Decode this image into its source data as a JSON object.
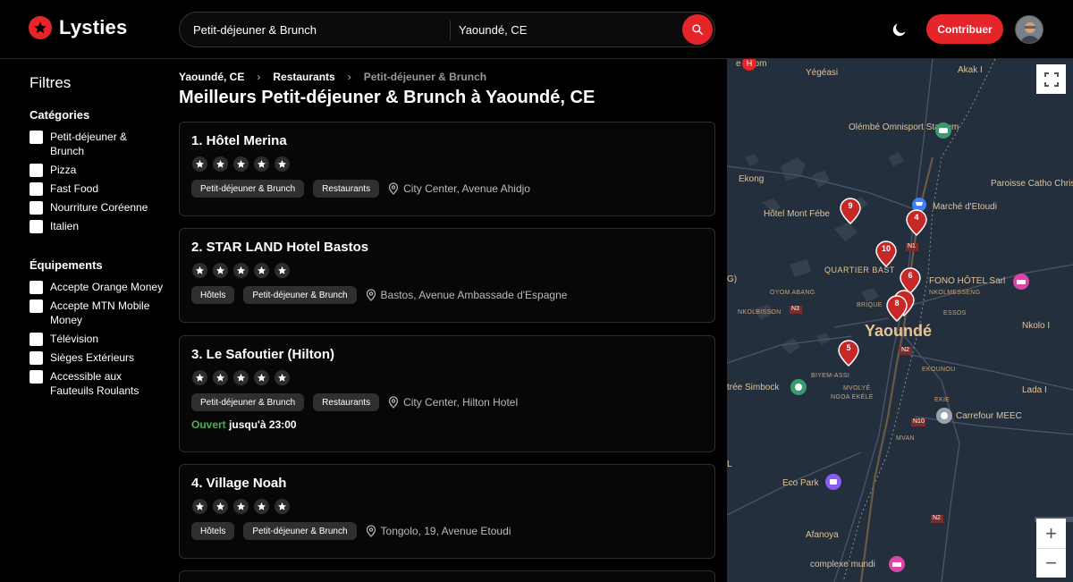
{
  "brand": {
    "name": "Lysties",
    "accent": "#e5252a"
  },
  "search": {
    "query": "Petit-déjeuner & Brunch",
    "location": "Yaoundé, CE"
  },
  "header": {
    "contribute_label": "Contribuer"
  },
  "sidebar": {
    "title": "Filtres",
    "categories_title": "Catégories",
    "categories": [
      "Petit-déjeuner & Brunch",
      "Pizza",
      "Fast Food",
      "Nourriture Coréenne",
      "Italien"
    ],
    "amenities_title": "Équipements",
    "amenities": [
      "Accepte Orange Money",
      "Accepte MTN Mobile Money",
      "Télévision",
      "Sièges Extérieurs",
      "Accessible aux Fauteuils Roulants"
    ]
  },
  "breadcrumb": [
    "Yaoundé, CE",
    "Restaurants",
    "Petit-déjeuner & Brunch"
  ],
  "page_title": "Meilleurs Petit-déjeuner & Brunch à Yaoundé, CE",
  "listings": [
    {
      "title": "1. Hôtel Merina",
      "tags": [
        "Petit-déjeuner & Brunch",
        "Restaurants"
      ],
      "address": "City Center, Avenue Ahidjo"
    },
    {
      "title": "2. STAR LAND Hotel Bastos",
      "tags": [
        "Hôtels",
        "Petit-déjeuner & Brunch"
      ],
      "address": "Bastos, Avenue Ambassade d'Espagne"
    },
    {
      "title": "3. Le Safoutier (Hilton)",
      "tags": [
        "Petit-déjeuner & Brunch",
        "Restaurants"
      ],
      "address": "City Center, Hilton Hotel",
      "open_status": "Ouvert",
      "hours": "jusqu'à 23:00"
    },
    {
      "title": "4. Village Noah",
      "tags": [
        "Hôtels",
        "Petit-déjeuner & Brunch"
      ],
      "address": "Tongolo, 19, Avenue Etoudi"
    }
  ],
  "map": {
    "labels": {
      "yegeasi": "Yégéasi",
      "akak": "Akak I",
      "stadium": "Olémbé Omnisport Stadium",
      "ekong": "Ekong",
      "paroisse": "Paroisse Catho Christ Roi Melen B",
      "hotel_mont": "Hôtel Mont Fébe",
      "marche": "Marché d'Etoudi",
      "quartier": "QUARTIER BAST",
      "fono": "FONO HÔTEL Sarl",
      "oyom": "OYOM ABANG",
      "nkolmesseng": "NKOLMESSENG",
      "nkolbisson": "NKOLBISSON",
      "essos": "ESSOS",
      "yaounde": "Yaoundé",
      "nkolo": "Nkolo I",
      "biyem": "BIYEM-ASSI",
      "ekounou": "EKOUNOU",
      "simbock": "trée Simbock",
      "mvolye": "MVOLYÉ",
      "ngoa": "NGOA EKÉLÉ",
      "ekie": "EKIE",
      "carrefour": "Carrefour MEEC",
      "lada": "Lada I",
      "mvan": "MVAN",
      "ecopark": "Eco Park",
      "afanoya": "Afanoya",
      "complexe": "complexe mundi",
      "n1": "N1",
      "n3": "N3",
      "n2": "N2",
      "n10": "N10",
      "brique": "BRIQUE",
      "g": "G)",
      "l": "L",
      "de_nyom": "e Nyom"
    },
    "pins": [
      "9",
      "4",
      "10",
      "6",
      "8",
      "5"
    ],
    "zoom_in": "+",
    "zoom_out": "−"
  }
}
